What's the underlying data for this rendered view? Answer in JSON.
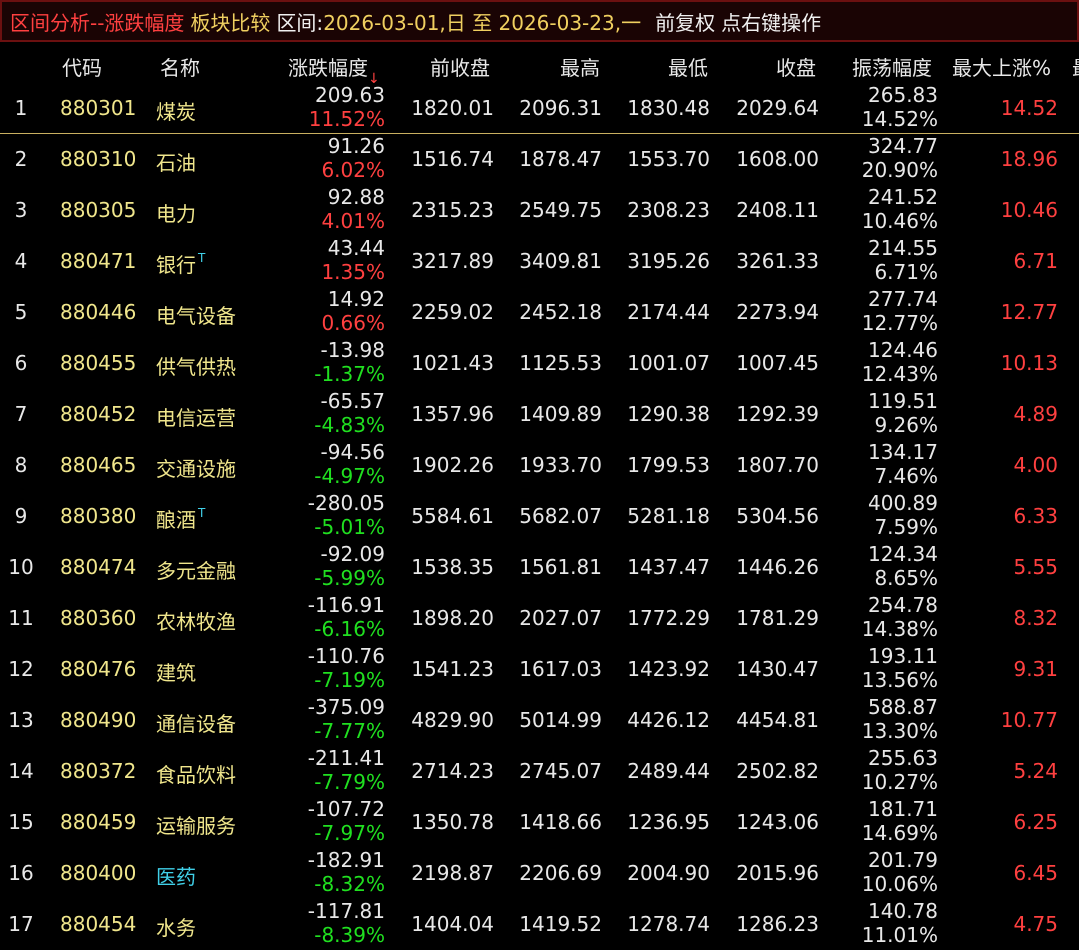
{
  "title": {
    "main": "区间分析--涨跌幅度",
    "sub": "板块比较",
    "range_label": "区间:",
    "range_value": "2026-03-01,日 至 2026-03-23,一",
    "adjust": "前复权",
    "hint": "点右键操作"
  },
  "columns": {
    "code": "代码",
    "name": "名称",
    "change": "涨跌幅度",
    "sort_arrow": "↓",
    "prev_close": "前收盘",
    "high": "最高",
    "low": "最低",
    "close": "收盘",
    "amplitude": "振荡幅度",
    "max_up": "最大上涨%",
    "cutoff": "最"
  },
  "colors": {
    "up": "#ff4040",
    "down": "#20e020",
    "code": "#f0e68c",
    "highlight_name": "#40d0e8"
  },
  "rows": [
    {
      "idx": "1",
      "code": "880301",
      "name": "煤炭",
      "mark": "",
      "chg": "209.63",
      "pct": "11.52%",
      "dir": "up",
      "prev": "1820.01",
      "high": "2096.31",
      "low": "1830.48",
      "close": "2029.64",
      "amp": "265.83",
      "amp_pct": "14.52%",
      "maxup": "14.52"
    },
    {
      "idx": "2",
      "code": "880310",
      "name": "石油",
      "mark": "",
      "chg": "91.26",
      "pct": "6.02%",
      "dir": "up",
      "prev": "1516.74",
      "high": "1878.47",
      "low": "1553.70",
      "close": "1608.00",
      "amp": "324.77",
      "amp_pct": "20.90%",
      "maxup": "18.96"
    },
    {
      "idx": "3",
      "code": "880305",
      "name": "电力",
      "mark": "",
      "chg": "92.88",
      "pct": "4.01%",
      "dir": "up",
      "prev": "2315.23",
      "high": "2549.75",
      "low": "2308.23",
      "close": "2408.11",
      "amp": "241.52",
      "amp_pct": "10.46%",
      "maxup": "10.46"
    },
    {
      "idx": "4",
      "code": "880471",
      "name": "银行",
      "mark": "T",
      "chg": "43.44",
      "pct": "1.35%",
      "dir": "up",
      "prev": "3217.89",
      "high": "3409.81",
      "low": "3195.26",
      "close": "3261.33",
      "amp": "214.55",
      "amp_pct": "6.71%",
      "maxup": "6.71"
    },
    {
      "idx": "5",
      "code": "880446",
      "name": "电气设备",
      "mark": "",
      "chg": "14.92",
      "pct": "0.66%",
      "dir": "up",
      "prev": "2259.02",
      "high": "2452.18",
      "low": "2174.44",
      "close": "2273.94",
      "amp": "277.74",
      "amp_pct": "12.77%",
      "maxup": "12.77"
    },
    {
      "idx": "6",
      "code": "880455",
      "name": "供气供热",
      "mark": "",
      "chg": "-13.98",
      "pct": "-1.37%",
      "dir": "down",
      "prev": "1021.43",
      "high": "1125.53",
      "low": "1001.07",
      "close": "1007.45",
      "amp": "124.46",
      "amp_pct": "12.43%",
      "maxup": "10.13"
    },
    {
      "idx": "7",
      "code": "880452",
      "name": "电信运营",
      "mark": "",
      "chg": "-65.57",
      "pct": "-4.83%",
      "dir": "down",
      "prev": "1357.96",
      "high": "1409.89",
      "low": "1290.38",
      "close": "1292.39",
      "amp": "119.51",
      "amp_pct": "9.26%",
      "maxup": "4.89"
    },
    {
      "idx": "8",
      "code": "880465",
      "name": "交通设施",
      "mark": "",
      "chg": "-94.56",
      "pct": "-4.97%",
      "dir": "down",
      "prev": "1902.26",
      "high": "1933.70",
      "low": "1799.53",
      "close": "1807.70",
      "amp": "134.17",
      "amp_pct": "7.46%",
      "maxup": "4.00"
    },
    {
      "idx": "9",
      "code": "880380",
      "name": "酿酒",
      "mark": "T",
      "chg": "-280.05",
      "pct": "-5.01%",
      "dir": "down",
      "prev": "5584.61",
      "high": "5682.07",
      "low": "5281.18",
      "close": "5304.56",
      "amp": "400.89",
      "amp_pct": "7.59%",
      "maxup": "6.33"
    },
    {
      "idx": "10",
      "code": "880474",
      "name": "多元金融",
      "mark": "",
      "chg": "-92.09",
      "pct": "-5.99%",
      "dir": "down",
      "prev": "1538.35",
      "high": "1561.81",
      "low": "1437.47",
      "close": "1446.26",
      "amp": "124.34",
      "amp_pct": "8.65%",
      "maxup": "5.55"
    },
    {
      "idx": "11",
      "code": "880360",
      "name": "农林牧渔",
      "mark": "",
      "chg": "-116.91",
      "pct": "-6.16%",
      "dir": "down",
      "prev": "1898.20",
      "high": "2027.07",
      "low": "1772.29",
      "close": "1781.29",
      "amp": "254.78",
      "amp_pct": "14.38%",
      "maxup": "8.32"
    },
    {
      "idx": "12",
      "code": "880476",
      "name": "建筑",
      "mark": "",
      "chg": "-110.76",
      "pct": "-7.19%",
      "dir": "down",
      "prev": "1541.23",
      "high": "1617.03",
      "low": "1423.92",
      "close": "1430.47",
      "amp": "193.11",
      "amp_pct": "13.56%",
      "maxup": "9.31"
    },
    {
      "idx": "13",
      "code": "880490",
      "name": "通信设备",
      "mark": "",
      "chg": "-375.09",
      "pct": "-7.77%",
      "dir": "down",
      "prev": "4829.90",
      "high": "5014.99",
      "low": "4426.12",
      "close": "4454.81",
      "amp": "588.87",
      "amp_pct": "13.30%",
      "maxup": "10.77"
    },
    {
      "idx": "14",
      "code": "880372",
      "name": "食品饮料",
      "mark": "",
      "chg": "-211.41",
      "pct": "-7.79%",
      "dir": "down",
      "prev": "2714.23",
      "high": "2745.07",
      "low": "2489.44",
      "close": "2502.82",
      "amp": "255.63",
      "amp_pct": "10.27%",
      "maxup": "5.24"
    },
    {
      "idx": "15",
      "code": "880459",
      "name": "运输服务",
      "mark": "",
      "chg": "-107.72",
      "pct": "-7.97%",
      "dir": "down",
      "prev": "1350.78",
      "high": "1418.66",
      "low": "1236.95",
      "close": "1243.06",
      "amp": "181.71",
      "amp_pct": "14.69%",
      "maxup": "6.25"
    },
    {
      "idx": "16",
      "code": "880400",
      "name": "医药",
      "mark": "",
      "name_color": "cyan",
      "chg": "-182.91",
      "pct": "-8.32%",
      "dir": "down",
      "prev": "2198.87",
      "high": "2206.69",
      "low": "2004.90",
      "close": "2015.96",
      "amp": "201.79",
      "amp_pct": "10.06%",
      "maxup": "6.45"
    },
    {
      "idx": "17",
      "code": "880454",
      "name": "水务",
      "mark": "",
      "chg": "-117.81",
      "pct": "-8.39%",
      "dir": "down",
      "prev": "1404.04",
      "high": "1419.52",
      "low": "1278.74",
      "close": "1286.23",
      "amp": "140.78",
      "amp_pct": "11.01%",
      "maxup": "4.75"
    }
  ]
}
